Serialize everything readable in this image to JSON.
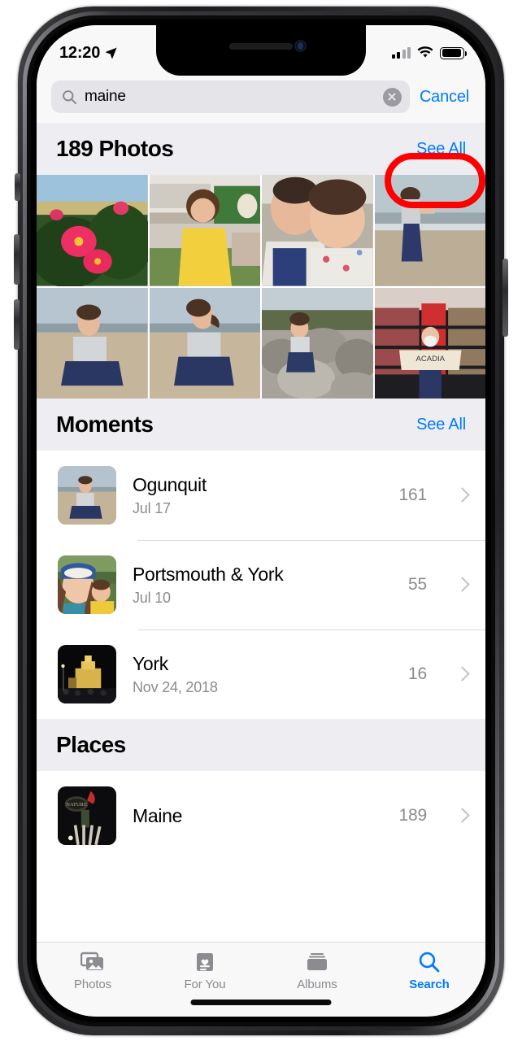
{
  "status_bar": {
    "time": "12:20",
    "location_icon": "location-arrow-icon",
    "signal_icon": "cellular-signal-icon",
    "wifi_icon": "wifi-icon",
    "battery_icon": "battery-full-icon"
  },
  "search": {
    "icon": "search-icon",
    "value": "maine",
    "placeholder": "Search",
    "clear_icon": "clear-circle-icon",
    "cancel_label": "Cancel"
  },
  "photos_section": {
    "title": "189 Photos",
    "see_all_label": "See All",
    "count": 189,
    "photos": [
      {
        "id": "photo-1",
        "caption": "pink rose bushes in bloom"
      },
      {
        "id": "photo-2",
        "caption": "toddler in yellow dress with ice cream"
      },
      {
        "id": "photo-3",
        "caption": "woman and baby selfie"
      },
      {
        "id": "photo-4",
        "caption": "woman walking on the beach"
      },
      {
        "id": "photo-5",
        "caption": "woman sitting on beach sand"
      },
      {
        "id": "photo-6",
        "caption": "woman seated facing the ocean"
      },
      {
        "id": "photo-7",
        "caption": "woman sitting on coastal rocks"
      },
      {
        "id": "photo-8",
        "caption": "woman in Acadia sweatshirt at a store"
      }
    ]
  },
  "moments_section": {
    "title": "Moments",
    "see_all_label": "See All",
    "rows": [
      {
        "title": "Ogunquit",
        "subtitle": "Jul 17",
        "count": "161",
        "thumb": "woman sitting on beach"
      },
      {
        "title": "Portsmouth & York",
        "subtitle": "Jul 10",
        "count": "55",
        "thumb": "woman in blue hat with toddler"
      },
      {
        "title": "York",
        "subtitle": "Nov 24, 2018",
        "count": "16",
        "thumb": "lit building at night"
      }
    ]
  },
  "places_section": {
    "title": "Places",
    "rows": [
      {
        "title": "Maine",
        "subtitle": "",
        "count": "189",
        "thumb": "dark storefront sign"
      }
    ]
  },
  "tab_bar": {
    "tabs": [
      {
        "label": "Photos",
        "icon": "photos-icon",
        "active": false
      },
      {
        "label": "For You",
        "icon": "for-you-icon",
        "active": false
      },
      {
        "label": "Albums",
        "icon": "albums-icon",
        "active": false
      },
      {
        "label": "Search",
        "icon": "search-icon",
        "active": true
      }
    ]
  },
  "annotation": {
    "shape": "rounded-rectangle-outline",
    "color": "#ff0000",
    "targets": "See All"
  },
  "colors": {
    "accent_blue": "#007aff",
    "section_header_bg": "#eeeef2",
    "secondary_text": "#8b8b90",
    "chevron": "#c3c3c8",
    "annotation_red": "#ff0000"
  }
}
